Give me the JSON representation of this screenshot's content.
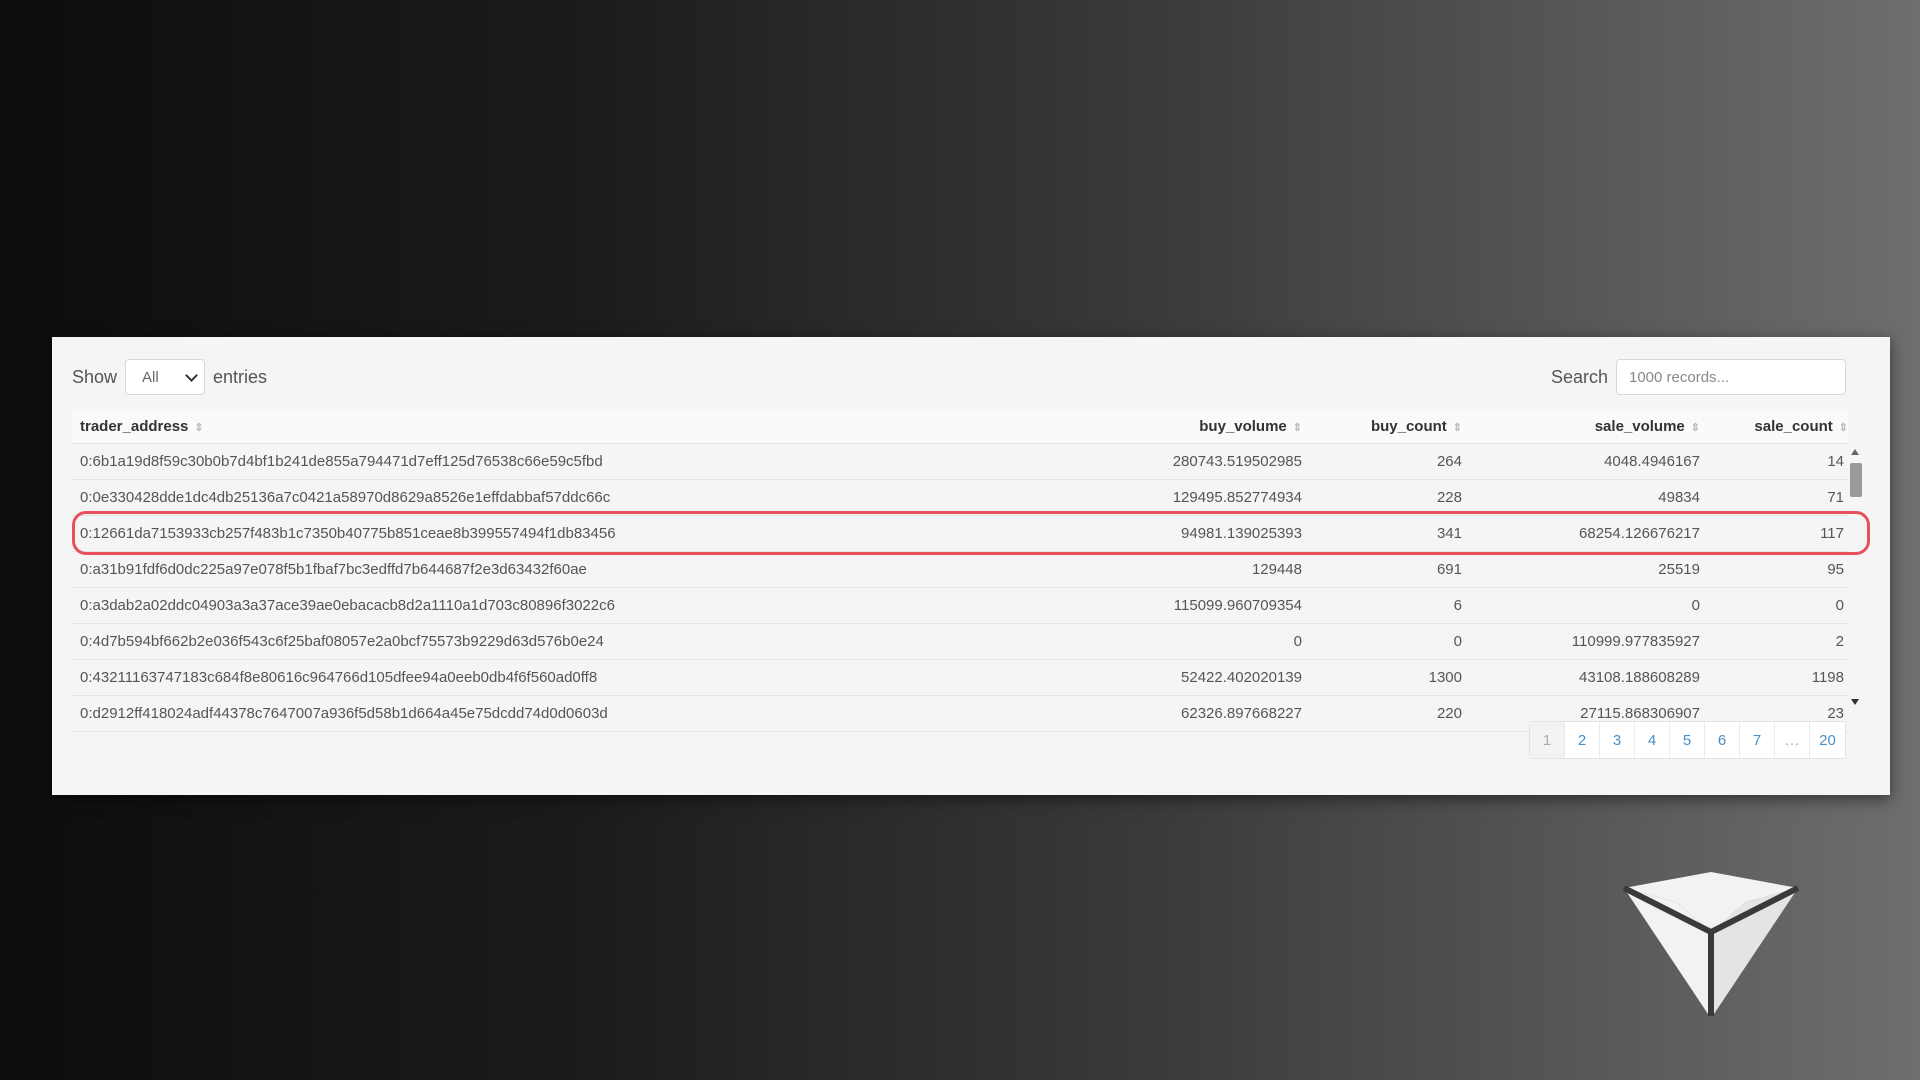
{
  "length_control": {
    "show_label": "Show",
    "selected": "All",
    "entries_label": "entries"
  },
  "search": {
    "label": "Search",
    "placeholder": "1000 records..."
  },
  "table": {
    "headers": [
      "trader_address",
      "buy_volume",
      "buy_count",
      "sale_volume",
      "sale_count"
    ],
    "rows": [
      [
        "0:6b1a19d8f59c30b0b7d4bf1b241de855a794471d7eff125d76538c66e59c5fbd",
        "280743.519502985",
        "264",
        "4048.4946167",
        "14"
      ],
      [
        "0:0e330428dde1dc4db25136a7c0421a58970d8629a8526e1effdabbaf57ddc66c",
        "129495.852774934",
        "228",
        "49834",
        "71"
      ],
      [
        "0:12661da7153933cb257f483b1c7350b40775b851ceae8b399557494f1db83456",
        "94981.139025393",
        "341",
        "68254.126676217",
        "117"
      ],
      [
        "0:a31b91fdf6d0dc225a97e078f5b1fbaf7bc3edffd7b644687f2e3d63432f60ae",
        "129448",
        "691",
        "25519",
        "95"
      ],
      [
        "0:a3dab2a02ddc04903a3a37ace39ae0ebacacb8d2a1110a1d703c80896f3022c6",
        "115099.960709354",
        "6",
        "0",
        "0"
      ],
      [
        "0:4d7b594bf662b2e036f543c6f25baf08057e2a0bcf75573b9229d63d576b0e24",
        "0",
        "0",
        "110999.977835927",
        "2"
      ],
      [
        "0:43211163747183c684f8e80616c964766d105dfee94a0eeb0db4f6f560ad0ff8",
        "52422.402020139",
        "1300",
        "43108.188608289",
        "1198"
      ],
      [
        "0:d2912ff418024adf44378c7647007a936f5d58b1d664a45e75dcdd74d0d0603d",
        "62326.897668227",
        "220",
        "27115.868306907",
        "23"
      ]
    ]
  },
  "pagination": {
    "pages": [
      "1",
      "2",
      "3",
      "4",
      "5",
      "6",
      "7",
      "…",
      "20"
    ],
    "active": "1"
  },
  "colors": {
    "highlight": "#e8505b",
    "link": "#4a8fc4"
  }
}
